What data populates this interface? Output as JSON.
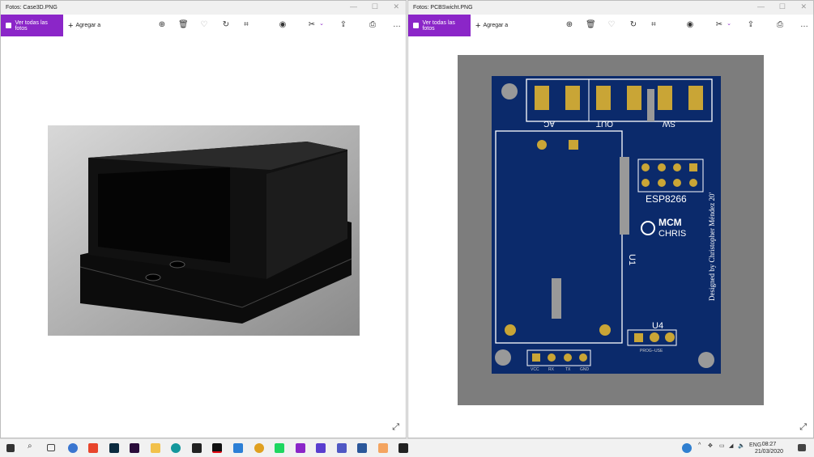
{
  "windows": [
    {
      "title": "Fotos: Case3D.PNG",
      "view_all": "Ver todas las fotos",
      "add_to": "Agregar a"
    },
    {
      "title": "Fotos: PCBSwicht.PNG",
      "view_all": "Ver todas las fotos",
      "add_to": "Agregar a"
    }
  ],
  "pcb": {
    "labels": {
      "ac": "AC",
      "out": "OUT",
      "sw": "SW",
      "esp": "ESP8266",
      "u1": "U1",
      "u4": "U4",
      "prog": "PROG--USE",
      "vcc": "VCC",
      "rx": "RX",
      "tx": "TX",
      "gnd": "GND",
      "designer": "Designed by Christopher Méndez 20'",
      "logo1": "MCM",
      "logo2": "CHRIS"
    }
  },
  "taskbar": {
    "lang": "ENG",
    "time": "08:27",
    "date": "21/03/2020",
    "accent": "#8b26c8"
  }
}
